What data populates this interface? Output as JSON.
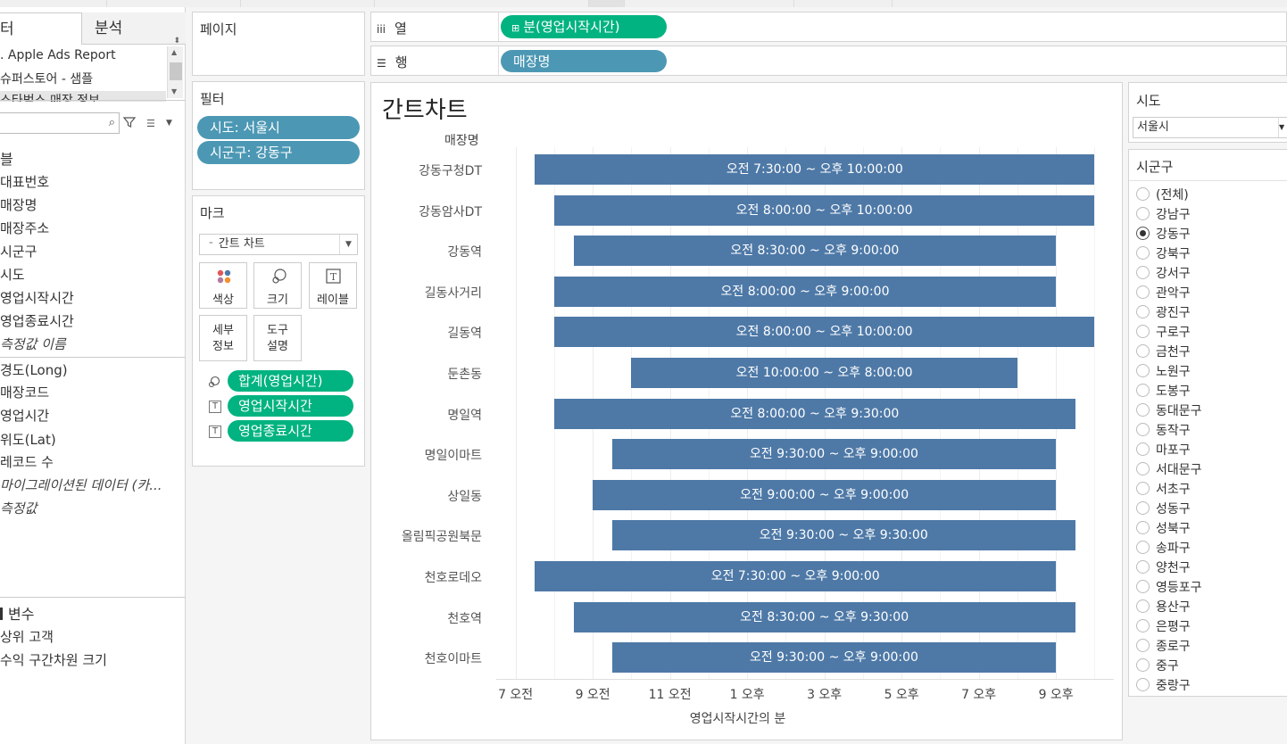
{
  "data_pane": {
    "tabs": [
      "터",
      "분석"
    ],
    "datasources": [
      ". Apple Ads Report",
      "슈퍼스토어 - 샘플",
      "스타벅스 매장 정보"
    ],
    "dimensions_header": "블",
    "dimensions": [
      "대표번호",
      "매장명",
      "매장주소",
      "시군구",
      "시도",
      "영업시작시간",
      "영업종료시간"
    ],
    "measure_names": "측정값 이름",
    "measures": [
      "경도(Long)",
      "매장코드",
      "영업시간",
      "위도(Lat)",
      "레코드 수"
    ],
    "migrated": "마이그레이션된 데이터 (카...",
    "measure_values": "측정값",
    "params_header": "변수",
    "params": [
      "상위 고객",
      "수익 구간차원 크기"
    ]
  },
  "cards": {
    "pages": "페이지",
    "filters_title": "필터",
    "filters": [
      "시도: 서울시",
      "시군구: 강동구"
    ],
    "marks_title": "마크",
    "mark_type": "간트 차트",
    "mark_buttons": {
      "color": "색상",
      "size": "크기",
      "label": "레이블",
      "detail_1": "세부",
      "detail_2": "정보",
      "tooltip_1": "도구",
      "tooltip_2": "설명"
    },
    "mark_pills": [
      "합계(영업시간)",
      "영업시작시간",
      "영업종료시간"
    ]
  },
  "shelves": {
    "columns_label": "열",
    "columns_pill": "분(영업시작시간)",
    "rows_label": "행",
    "rows_pill": "매장명"
  },
  "chart_data": {
    "type": "gantt",
    "title": "간트차트",
    "row_header": "매장명",
    "xlabel": "영업시작시간의 분",
    "x_range_hours": [
      6.5,
      22.0
    ],
    "x_ticks": [
      {
        "h": 7,
        "label": "7 오전"
      },
      {
        "h": 9,
        "label": "9 오전"
      },
      {
        "h": 11,
        "label": "11 오전"
      },
      {
        "h": 13,
        "label": "1 오후"
      },
      {
        "h": 15,
        "label": "3 오후"
      },
      {
        "h": 17,
        "label": "5 오후"
      },
      {
        "h": 19,
        "label": "7 오후"
      },
      {
        "h": 21,
        "label": "9 오후"
      }
    ],
    "rows": [
      {
        "name": "강동구청DT",
        "start": 7.5,
        "end": 22.0,
        "label": "오전 7:30:00 ~ 오후 10:00:00"
      },
      {
        "name": "강동암사DT",
        "start": 8.0,
        "end": 22.0,
        "label": "오전 8:00:00 ~ 오후 10:00:00"
      },
      {
        "name": "강동역",
        "start": 8.5,
        "end": 21.0,
        "label": "오전 8:30:00 ~ 오후 9:00:00"
      },
      {
        "name": "길동사거리",
        "start": 8.0,
        "end": 21.0,
        "label": "오전 8:00:00 ~ 오후 9:00:00"
      },
      {
        "name": "길동역",
        "start": 8.0,
        "end": 22.0,
        "label": "오전 8:00:00 ~ 오후 10:00:00"
      },
      {
        "name": "둔촌동",
        "start": 10.0,
        "end": 20.0,
        "label": "오전 10:00:00 ~ 오후 8:00:00"
      },
      {
        "name": "명일역",
        "start": 8.0,
        "end": 21.5,
        "label": "오전 8:00:00 ~ 오후 9:30:00"
      },
      {
        "name": "명일이마트",
        "start": 9.5,
        "end": 21.0,
        "label": "오전 9:30:00 ~ 오후 9:00:00"
      },
      {
        "name": "상일동",
        "start": 9.0,
        "end": 21.0,
        "label": "오전 9:00:00 ~ 오후 9:00:00"
      },
      {
        "name": "올림픽공원북문",
        "start": 9.5,
        "end": 21.5,
        "label": "오전 9:30:00 ~ 오후 9:30:00"
      },
      {
        "name": "천호로데오",
        "start": 7.5,
        "end": 21.0,
        "label": "오전 7:30:00 ~ 오후 9:00:00"
      },
      {
        "name": "천호역",
        "start": 8.5,
        "end": 21.5,
        "label": "오전 8:30:00 ~ 오후 9:30:00"
      },
      {
        "name": "천호이마트",
        "start": 9.5,
        "end": 21.0,
        "label": "오전 9:30:00 ~ 오후 9:00:00"
      }
    ],
    "bar_color": "#4e79a7"
  },
  "filter_sido": {
    "title": "시도",
    "value": "서울시"
  },
  "filter_sigungu": {
    "title": "시군구",
    "selected": "강동구",
    "options": [
      "(전체)",
      "강남구",
      "강동구",
      "강북구",
      "강서구",
      "관악구",
      "광진구",
      "구로구",
      "금천구",
      "노원구",
      "도봉구",
      "동대문구",
      "동작구",
      "마포구",
      "서대문구",
      "서초구",
      "성동구",
      "성북구",
      "송파구",
      "양천구",
      "영등포구",
      "용산구",
      "은평구",
      "종로구",
      "중구",
      "중랑구"
    ]
  }
}
